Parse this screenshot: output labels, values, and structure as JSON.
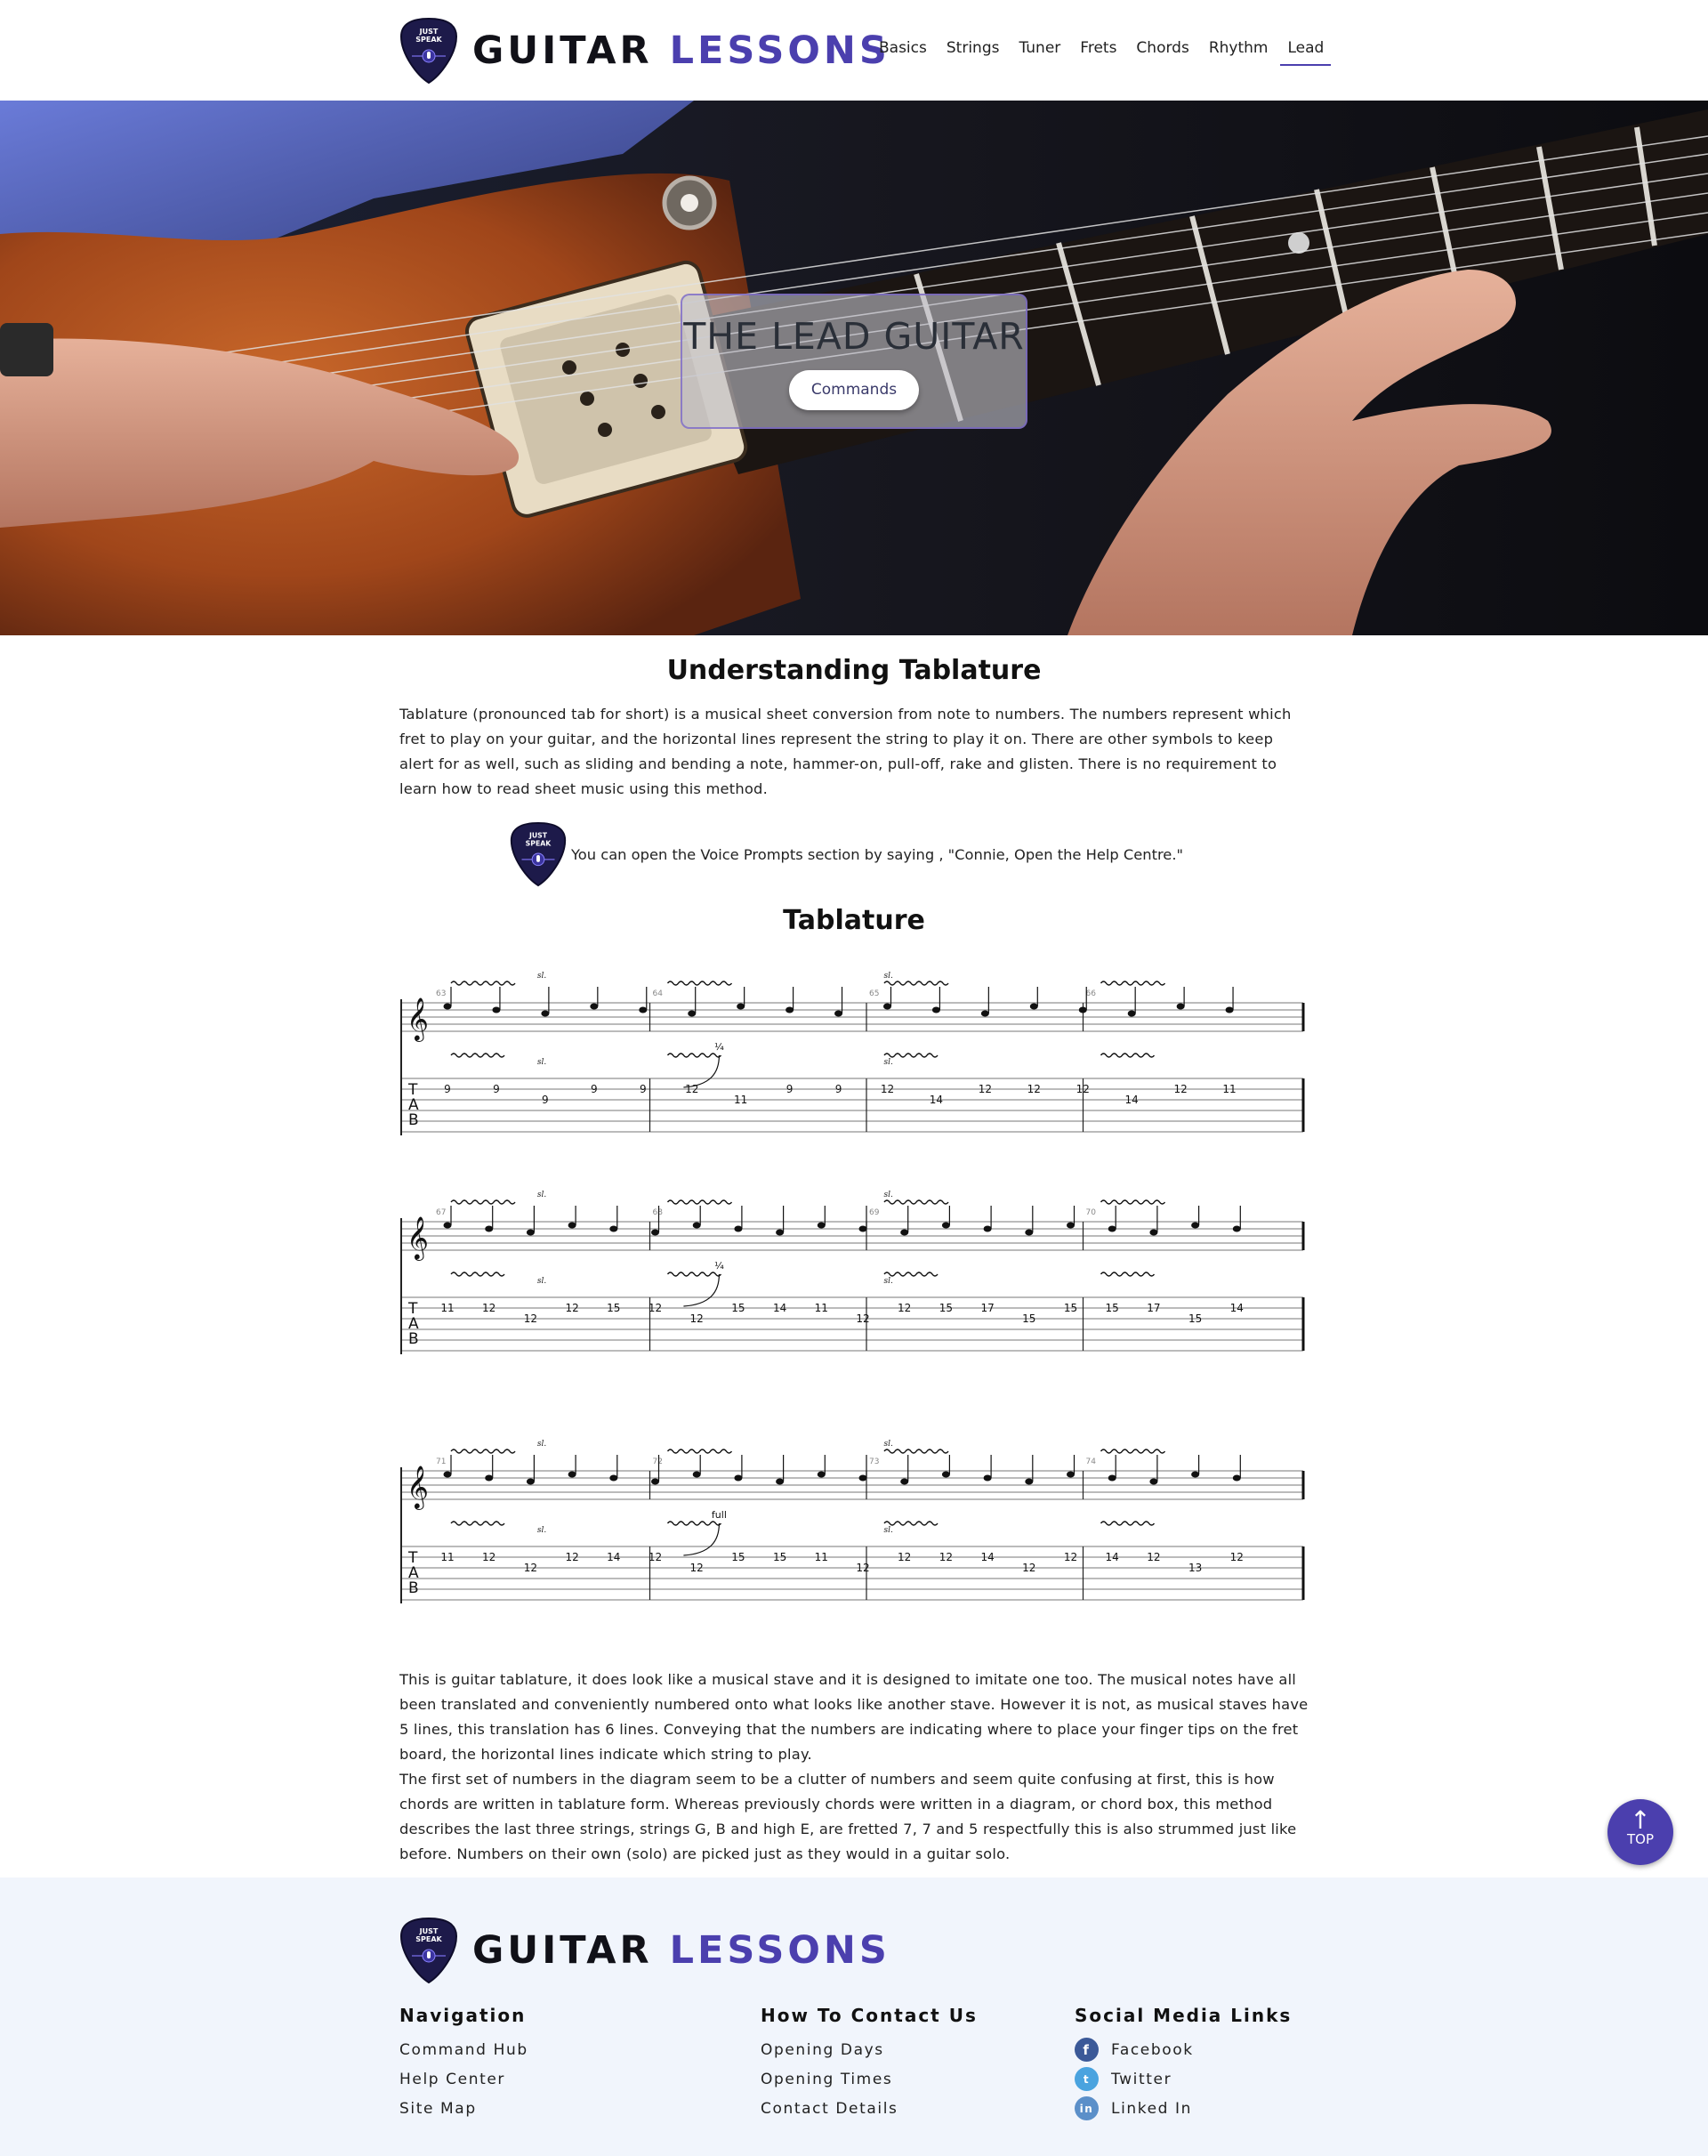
{
  "header": {
    "logo_badge_line1": "JUST",
    "logo_badge_line2": "SPEAK",
    "brand_part1": "GUITAR",
    "brand_part2": "LESSONS",
    "nav": [
      {
        "label": "Basics"
      },
      {
        "label": "Strings"
      },
      {
        "label": "Tuner"
      },
      {
        "label": "Frets"
      },
      {
        "label": "Chords"
      },
      {
        "label": "Rhythm"
      },
      {
        "label": "Lead",
        "active": true
      }
    ]
  },
  "hero": {
    "title": "THE LEAD GUITAR",
    "button_label": "Commands"
  },
  "main": {
    "heading": "Understanding Tablature",
    "intro": "Tablature (pronounced tab for short) is a musical sheet conversion from note to numbers. The numbers represent which fret to play on your guitar, and the horizontal lines represent the string to play it on. There are other symbols to keep alert for as well, such as sliding and bending a note, hammer-on, pull-off, rake and glisten. There is no requirement to learn how to read sheet music using this method.",
    "tip": "You can open the Voice Prompts section by saying , \"Connie, Open the Help Centre.\"",
    "tab_heading": "Tablature",
    "body1": "This is guitar tablature, it does look like a musical stave and it is designed to imitate one too. The musical notes have all been translated and conveniently numbered onto what looks like another stave. However it is not, as musical staves have 5 lines, this translation has 6 lines. Conveying that the numbers are indicating where to place your finger tips on the fret board, the horizontal lines indicate which string to play.",
    "body2": "The first set of numbers in the diagram seem to be a clutter of numbers and seem quite confusing at first, this is how chords are written in tablature form. Whereas previously chords were written in a diagram, or chord box, this method describes the last three strings, strings G, B and high E, are fretted 7, 7 and 5 respectfully this is also strummed just like before. Numbers on their own (solo) are picked just as they would in a guitar solo."
  },
  "tablature": {
    "tab_letters": [
      "T",
      "A",
      "B"
    ],
    "slide_mark": "sl.",
    "bend_quarter": "¼",
    "bend_full": "full",
    "systems": [
      {
        "measures": [
          "63",
          "64",
          "65",
          "66"
        ],
        "tab_numbers": [
          "9",
          "9",
          "9",
          "9",
          "9",
          "12",
          "11",
          "9",
          "9",
          "12",
          "14",
          "12",
          "12",
          "12",
          "14",
          "12",
          "11"
        ]
      },
      {
        "measures": [
          "67",
          "68",
          "69",
          "70"
        ],
        "tab_numbers": [
          "11",
          "12",
          "12",
          "12",
          "15",
          "12",
          "12",
          "15",
          "14",
          "11",
          "12",
          "12",
          "15",
          "17",
          "15",
          "15",
          "15",
          "17",
          "15",
          "14"
        ]
      },
      {
        "measures": [
          "71",
          "72",
          "73",
          "74"
        ],
        "tab_numbers": [
          "11",
          "12",
          "12",
          "12",
          "14",
          "12",
          "12",
          "15",
          "15",
          "11",
          "12",
          "12",
          "12",
          "14",
          "12",
          "12",
          "14",
          "12",
          "13",
          "12"
        ]
      }
    ]
  },
  "footer": {
    "brand_part1": "GUITAR",
    "brand_part2": "LESSONS",
    "nav_title": "Navigation",
    "nav_links": [
      "Command Hub",
      "Help Center",
      "Site Map"
    ],
    "contact_title": "How To Contact Us",
    "contact_links": [
      "Opening Days",
      "Opening Times",
      "Contact Details"
    ],
    "social_title": "Social Media Links",
    "social_links": [
      {
        "label": "Facebook",
        "icon": "facebook-icon",
        "color": "#3b5998",
        "glyph": "f"
      },
      {
        "label": "Twitter",
        "icon": "twitter-icon",
        "color": "#4aa3df",
        "glyph": "t"
      },
      {
        "label": "Linked In",
        "icon": "linkedin-icon",
        "color": "#5b8fc9",
        "glyph": "in"
      }
    ]
  },
  "top_button": {
    "label": "TOP"
  },
  "colors": {
    "accent": "#4b3fae",
    "footer_bg": "#f1f5fc"
  }
}
